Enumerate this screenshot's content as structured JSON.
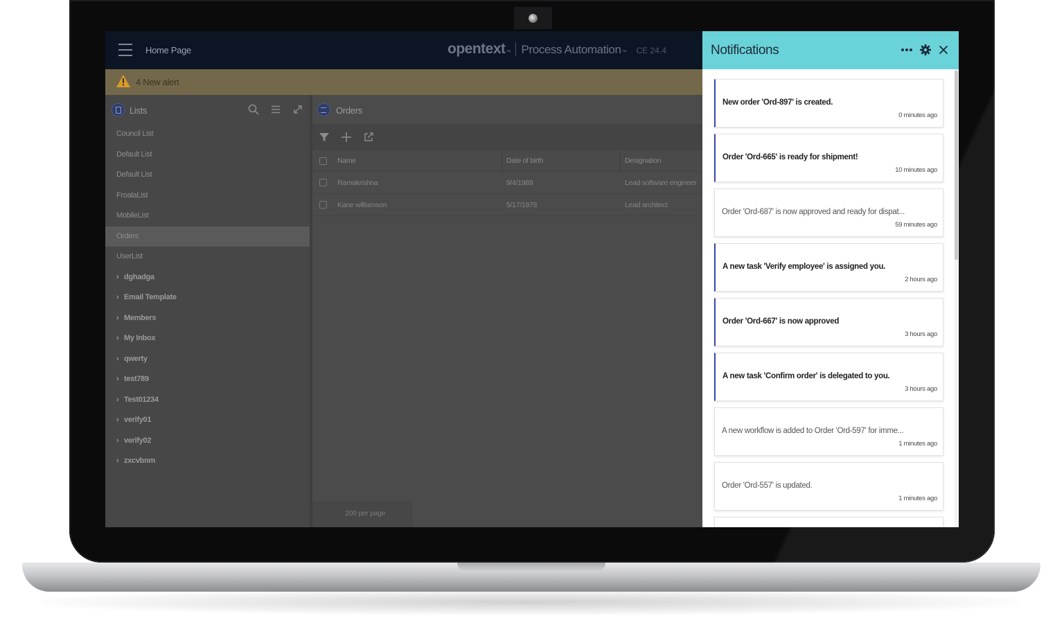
{
  "app": {
    "home_title": "Home Page",
    "brand_logo": "opentext",
    "brand_tm": "™",
    "brand_product": "Process Automation",
    "brand_product_tm": "™",
    "brand_version": "CE 24.4"
  },
  "alert": {
    "text": "4 New alert",
    "color": "#e0a72a"
  },
  "lists": {
    "title": "Lists",
    "items": [
      {
        "label": "Council List",
        "group": false,
        "active": false
      },
      {
        "label": "Default List",
        "group": false,
        "active": false
      },
      {
        "label": "Default List",
        "group": false,
        "active": false
      },
      {
        "label": "FroalaList",
        "group": false,
        "active": false
      },
      {
        "label": "MobileList",
        "group": false,
        "active": false
      },
      {
        "label": "Orders",
        "group": false,
        "active": true
      },
      {
        "label": "UserList",
        "group": false,
        "active": false
      },
      {
        "label": "dghadga",
        "group": true,
        "active": false
      },
      {
        "label": "Email Template",
        "group": true,
        "active": false
      },
      {
        "label": "Members",
        "group": true,
        "active": false
      },
      {
        "label": "My Inbox",
        "group": true,
        "active": false
      },
      {
        "label": "qwerty",
        "group": true,
        "active": false
      },
      {
        "label": "test789",
        "group": true,
        "active": false
      },
      {
        "label": "Test01234",
        "group": true,
        "active": false
      },
      {
        "label": "verify01",
        "group": true,
        "active": false
      },
      {
        "label": "verify02",
        "group": true,
        "active": false
      },
      {
        "label": "zxcvbnm",
        "group": true,
        "active": false
      }
    ]
  },
  "orders": {
    "title": "Orders",
    "columns": [
      "Name",
      "Date of birth",
      "Designation"
    ],
    "rows": [
      [
        "Ramakrishna",
        "9/4/1989",
        "Lead software engineer"
      ],
      [
        "Kane williamson",
        "5/17/1978",
        "Lead architect"
      ]
    ],
    "pager": "200 per page"
  },
  "notifications": {
    "title": "Notifications",
    "accent": "#6ad3d9",
    "unread_marker": "#3947a8",
    "items": [
      {
        "message": "New order 'Ord-897' is created.",
        "time": "0 minutes ago",
        "unread": true
      },
      {
        "message": "Order 'Ord-665' is ready for shipment!",
        "time": "10 minutes ago",
        "unread": true
      },
      {
        "message": "Order 'Ord-687' is now approved and ready for dispat...",
        "time": "59 minutes ago",
        "unread": false
      },
      {
        "message": "A new task 'Verify employee' is assigned you.",
        "time": "2 hours ago",
        "unread": true
      },
      {
        "message": "Order 'Ord-667' is now approved",
        "time": "3 hours ago",
        "unread": true
      },
      {
        "message": "A new task 'Confirm order' is delegated to you.",
        "time": "3 hours ago",
        "unread": true
      },
      {
        "message": "A new workflow is added to Order 'Ord-597' for imme...",
        "time": "1 minutes ago",
        "unread": false
      },
      {
        "message": "Order 'Ord-557' is updated.",
        "time": "1 minutes ago",
        "unread": false
      },
      {
        "message": "",
        "time": "",
        "unread": false
      }
    ]
  }
}
